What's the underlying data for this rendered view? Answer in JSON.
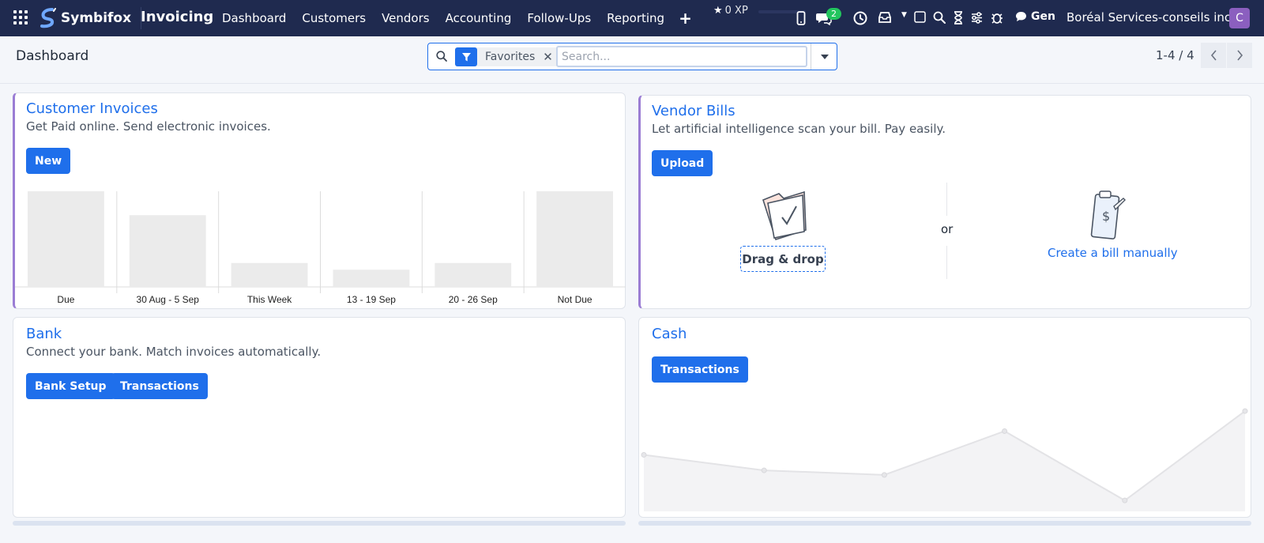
{
  "navbar": {
    "brand": "Symbifox",
    "app_title": "Invoicing",
    "menu": [
      "Dashboard",
      "Customers",
      "Vendors",
      "Accounting",
      "Follow-Ups",
      "Reporting"
    ],
    "xp": "0 XP",
    "messages_count": "2",
    "gen": "Gen",
    "company": "Boréal Services-conseils inc.",
    "avatar_letter": "C",
    "icons": [
      "apps-grid-icon",
      "mobile-icon",
      "chat-icon",
      "clock-icon",
      "inbox-icon",
      "caret-down-icon",
      "note-icon",
      "search-icon",
      "hourglass-icon",
      "sliders-icon",
      "bug-icon",
      "speech-bubble-icon"
    ]
  },
  "control": {
    "title": "Dashboard",
    "facet_label": "Favorites",
    "search_placeholder": "Search...",
    "pager": "1-4 / 4"
  },
  "cards": {
    "customer_invoices": {
      "title": "Customer Invoices",
      "description": "Get Paid online. Send electronic invoices.",
      "button": "New"
    },
    "vendor_bills": {
      "title": "Vendor Bills",
      "description": "Let artificial intelligence scan your bill. Pay easily.",
      "button": "Upload",
      "drag_drop": "Drag & drop",
      "or": "or",
      "manual": "Create a bill manually"
    },
    "bank": {
      "title": "Bank",
      "description": "Connect your bank. Match invoices automatically.",
      "buttons": [
        "Bank Setup",
        "Transactions"
      ]
    },
    "cash": {
      "title": "Cash",
      "button": "Transactions"
    }
  },
  "colors": {
    "navbar": "#1f2a4f",
    "accent": "#1f6feb",
    "card_accent": "#9b7dd4",
    "badge": "#22c55e",
    "placeholder_bar": "#ebebeb"
  },
  "chart_data": [
    {
      "type": "bar",
      "categories": [
        "Due",
        "30 Aug - 5 Sep",
        "This Week",
        "13 - 19 Sep",
        "20 - 26 Sep",
        "Not Due"
      ],
      "values": [
        100,
        75,
        25,
        18,
        25,
        100
      ],
      "ylim": [
        0,
        100
      ]
    },
    {
      "type": "area",
      "x": [
        1,
        2,
        3,
        4,
        5,
        6
      ],
      "values": [
        62,
        45,
        40,
        88,
        12,
        110
      ],
      "ylim": [
        0,
        130
      ]
    }
  ]
}
